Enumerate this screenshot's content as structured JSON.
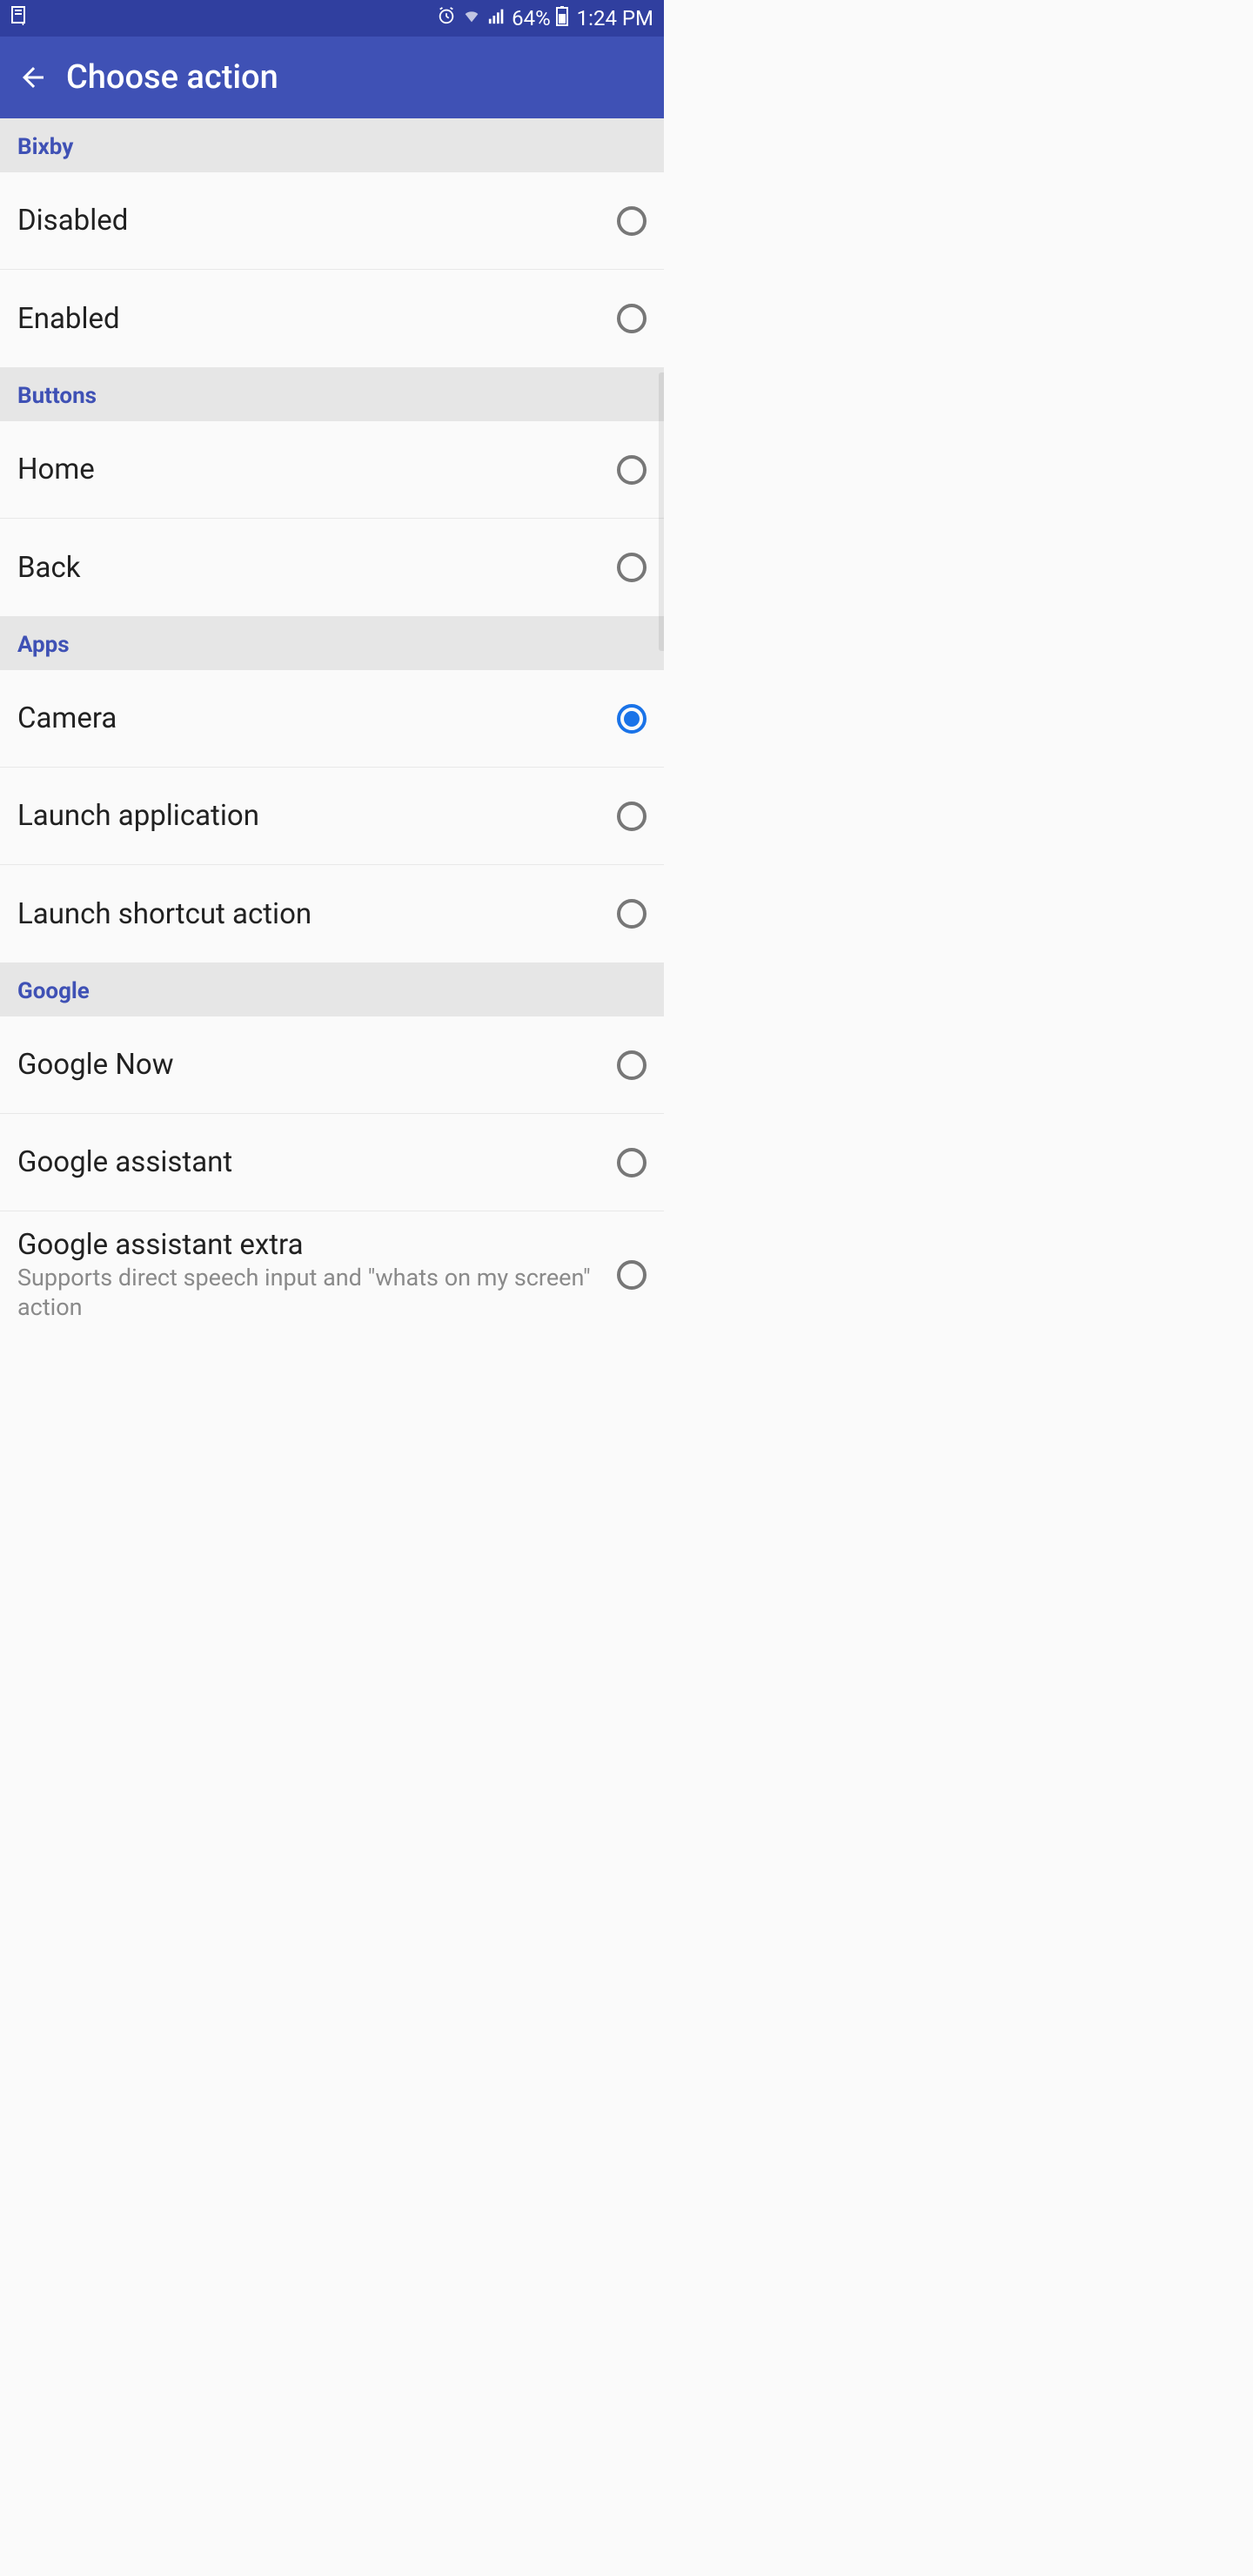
{
  "status": {
    "battery_text": "64%",
    "time": "1:24 PM"
  },
  "appbar": {
    "title": "Choose action"
  },
  "sections": [
    {
      "header": "Bixby",
      "items": [
        {
          "label": "Disabled",
          "selected": false
        },
        {
          "label": "Enabled",
          "selected": false
        }
      ]
    },
    {
      "header": "Buttons",
      "items": [
        {
          "label": "Home",
          "selected": false
        },
        {
          "label": "Back",
          "selected": false
        }
      ]
    },
    {
      "header": "Apps",
      "items": [
        {
          "label": "Camera",
          "selected": true
        },
        {
          "label": "Launch application",
          "selected": false
        },
        {
          "label": "Launch shortcut action",
          "selected": false
        }
      ]
    },
    {
      "header": "Google",
      "items": [
        {
          "label": "Google Now",
          "selected": false
        },
        {
          "label": "Google assistant",
          "selected": false
        },
        {
          "label": "Google assistant extra",
          "sub": "Supports direct speech input and \"whats on my screen\" action",
          "selected": false
        }
      ]
    }
  ]
}
